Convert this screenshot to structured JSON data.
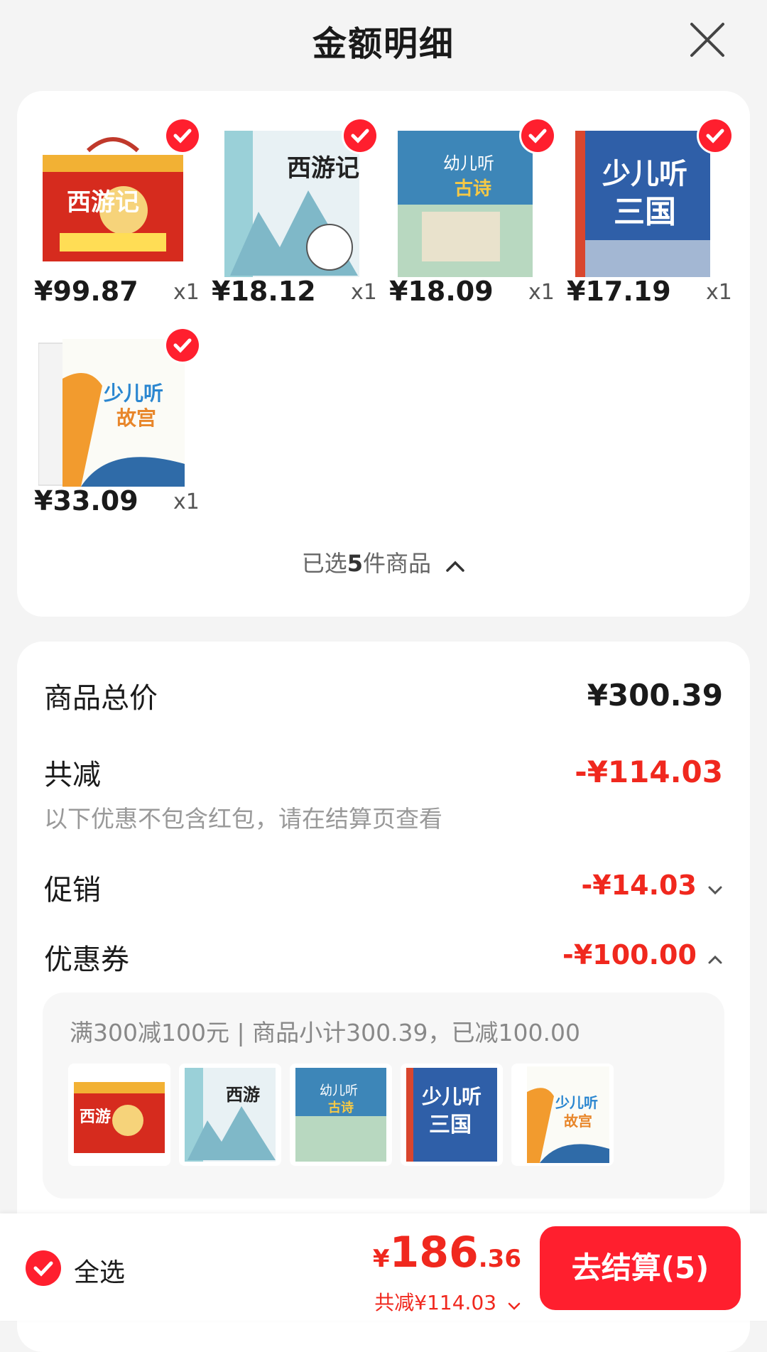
{
  "header": {
    "title": "金额明细"
  },
  "products": [
    {
      "price": "¥99.87",
      "qty": "x1",
      "cover_text": "西游记"
    },
    {
      "price": "¥18.12",
      "qty": "x1",
      "cover_text": "西游记"
    },
    {
      "price": "¥18.09",
      "qty": "x1",
      "cover_text": "幼儿听古诗"
    },
    {
      "price": "¥17.19",
      "qty": "x1",
      "cover_text": "少儿听三国"
    },
    {
      "price": "¥33.09",
      "qty": "x1",
      "cover_text": "少儿听故宫"
    }
  ],
  "selection": {
    "prefix": "已选",
    "count": "5",
    "suffix": "件商品"
  },
  "summary": {
    "total_label": "商品总价",
    "total_value": "¥300.39",
    "reduce_label": "共减",
    "reduce_value": "-¥114.03",
    "note": "以下优惠不包含红包，请在结算页查看",
    "promo_label": "促销",
    "promo_value": "-¥14.03",
    "coupon_label": "优惠券",
    "coupon_value": "-¥100.00",
    "coupon_detail": "满300减100元 | 商品小计300.39，已减100.00"
  },
  "bottom": {
    "select_all": "全选",
    "currency": "¥",
    "total_int": "186",
    "total_dec": ".36",
    "discount": "共减¥114.03",
    "checkout": "去结算(5)"
  },
  "colors": {
    "accent": "#ff1f2e",
    "negative": "#f0281e"
  }
}
